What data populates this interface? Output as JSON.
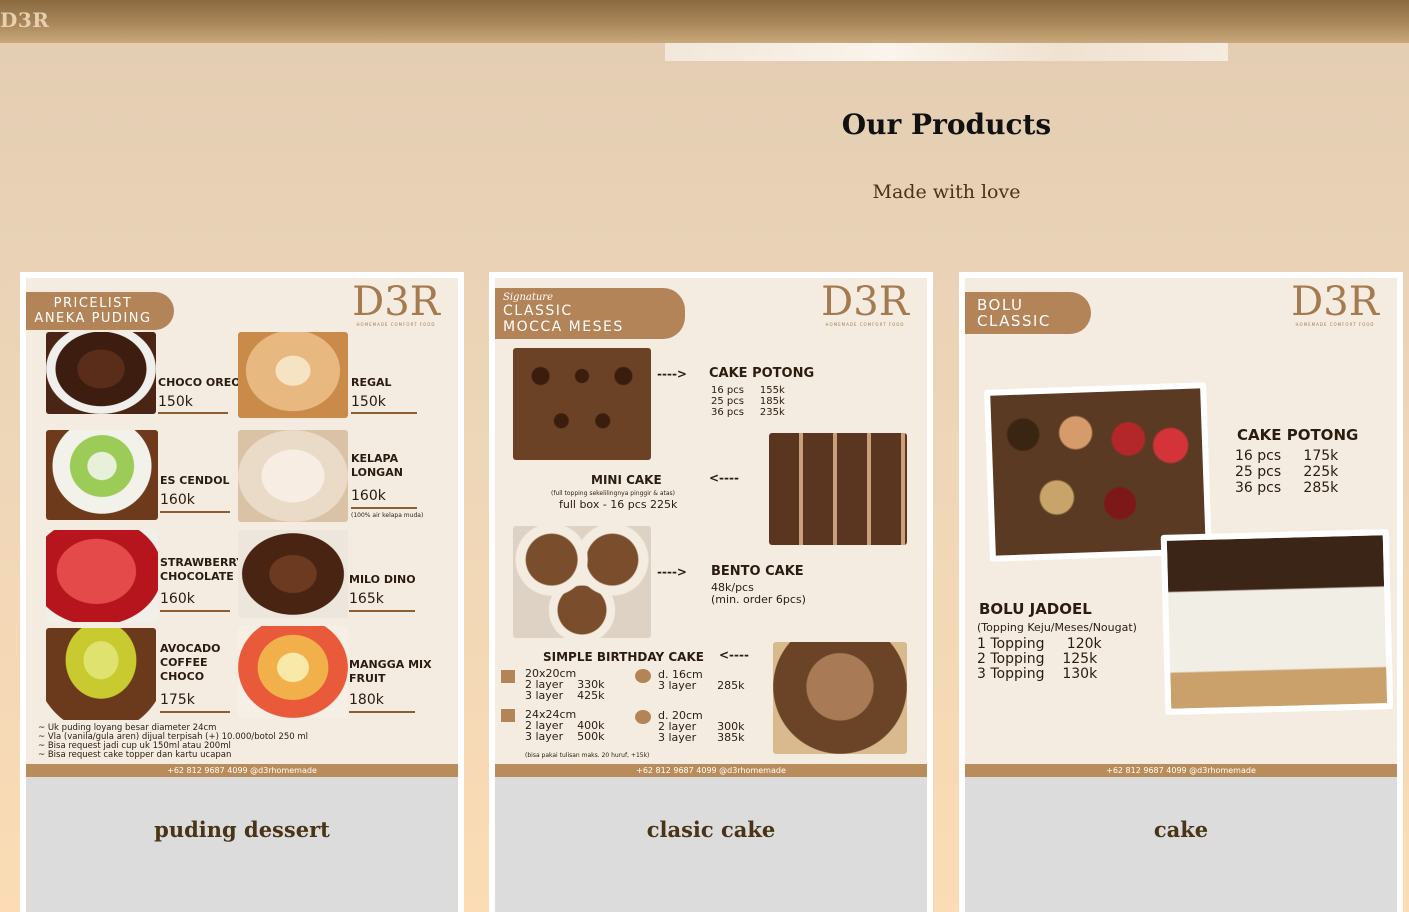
{
  "header": {
    "brand": "D3R"
  },
  "products_section": {
    "title": "Our Products",
    "subtitle": "Made with love"
  },
  "products": [
    {
      "caption": "puding dessert",
      "flyer": {
        "badge": [
          "PRICELIST",
          "ANEKA PUDING"
        ],
        "logo": "D3R",
        "logo_tagline": "HOMEMADE COMFORT FOOD",
        "items": [
          {
            "name": "CHOCO OREO",
            "price": "150k"
          },
          {
            "name": "REGAL",
            "price": "150k"
          },
          {
            "name": "ES CENDOL",
            "price": "160k"
          },
          {
            "name": "KELAPA LONGAN",
            "price": "160k",
            "note": "(100% air kelapa muda)"
          },
          {
            "name": "STRAWBERRY CHOCOLATE",
            "price": "160k"
          },
          {
            "name": "MILO DINO",
            "price": "165k"
          },
          {
            "name": "AVOCADO COFFEE CHOCO",
            "price": "175k"
          },
          {
            "name": "MANGGA MIX FRUIT",
            "price": "180k"
          }
        ],
        "notes": [
          "~ Uk puding loyang besar diameter 24cm",
          "~ Vla (vanila/gula aren) dijual terpisah (+) 10.000/botol 250 ml",
          "~ Bisa request jadi cup uk 150ml atau 200ml",
          "~ Bisa request cake topper dan kartu ucapan"
        ],
        "footer": "+62 812 9687 4099  @d3rhomemade"
      }
    },
    {
      "caption": "clasic cake",
      "flyer": {
        "badge_script": "Signature",
        "badge": [
          "CLASSIC",
          "MOCCA MESES"
        ],
        "logo": "D3R",
        "logo_tagline": "HOMEMADE COMFORT FOOD",
        "cake_potong": {
          "title": "CAKE POTONG",
          "rows": [
            [
              "16 pcs",
              "155k"
            ],
            [
              "25 pcs",
              "185k"
            ],
            [
              "36 pcs",
              "235k"
            ]
          ]
        },
        "mini_cake": {
          "title": "MINI CAKE",
          "note": "(full topping sekelilingnya pinggir & atas)",
          "line": "full box - 16 pcs    225k"
        },
        "bento": {
          "title": "BENTO CAKE",
          "lines": [
            "48k/pcs",
            "(min. order 6pcs)"
          ]
        },
        "birthday": {
          "title": "SIMPLE BIRTHDAY CAKE",
          "sizes": [
            {
              "size": "20x20cm",
              "rows": [
                [
                  "2 layer",
                  "330k"
                ],
                [
                  "3 layer",
                  "425k"
                ]
              ]
            },
            {
              "size": "d. 16cm",
              "rows": [
                [
                  "3 layer",
                  "285k"
                ]
              ]
            },
            {
              "size": "24x24cm",
              "rows": [
                [
                  "2 layer",
                  "400k"
                ],
                [
                  "3 layer",
                  "500k"
                ]
              ]
            },
            {
              "size": "d. 20cm",
              "rows": [
                [
                  "2 layer",
                  "300k"
                ],
                [
                  "3 layer",
                  "385k"
                ]
              ]
            }
          ],
          "note": "(bisa pakai tulisan maks. 20 huruf, +15k)"
        },
        "footer": "+62 812 9687 4099  @d3rhomemade"
      }
    },
    {
      "caption": "cake",
      "flyer": {
        "badge": [
          "BOLU",
          "CLASSIC"
        ],
        "logo": "D3R",
        "logo_tagline": "HOMEMADE COMFORT FOOD",
        "cake_potong": {
          "title": "CAKE POTONG",
          "rows": [
            [
              "16 pcs",
              "175k"
            ],
            [
              "25 pcs",
              "225k"
            ],
            [
              "36 pcs",
              "285k"
            ]
          ]
        },
        "jadoel": {
          "title": "BOLU JADOEL",
          "subtitle": "(Topping Keju/Meses/Nougat)",
          "rows": [
            [
              "1 Topping",
              "120k"
            ],
            [
              "2 Topping",
              "125k"
            ],
            [
              "3 Topping",
              "130k"
            ]
          ]
        },
        "footer": "+62 812 9687 4099  @d3rhomemade"
      }
    }
  ],
  "colors": {
    "accent": "#b48459",
    "caption_text": "#4a3418",
    "topbar": "#8a6a3f",
    "card_caption_bg": "#dcdcdc"
  }
}
